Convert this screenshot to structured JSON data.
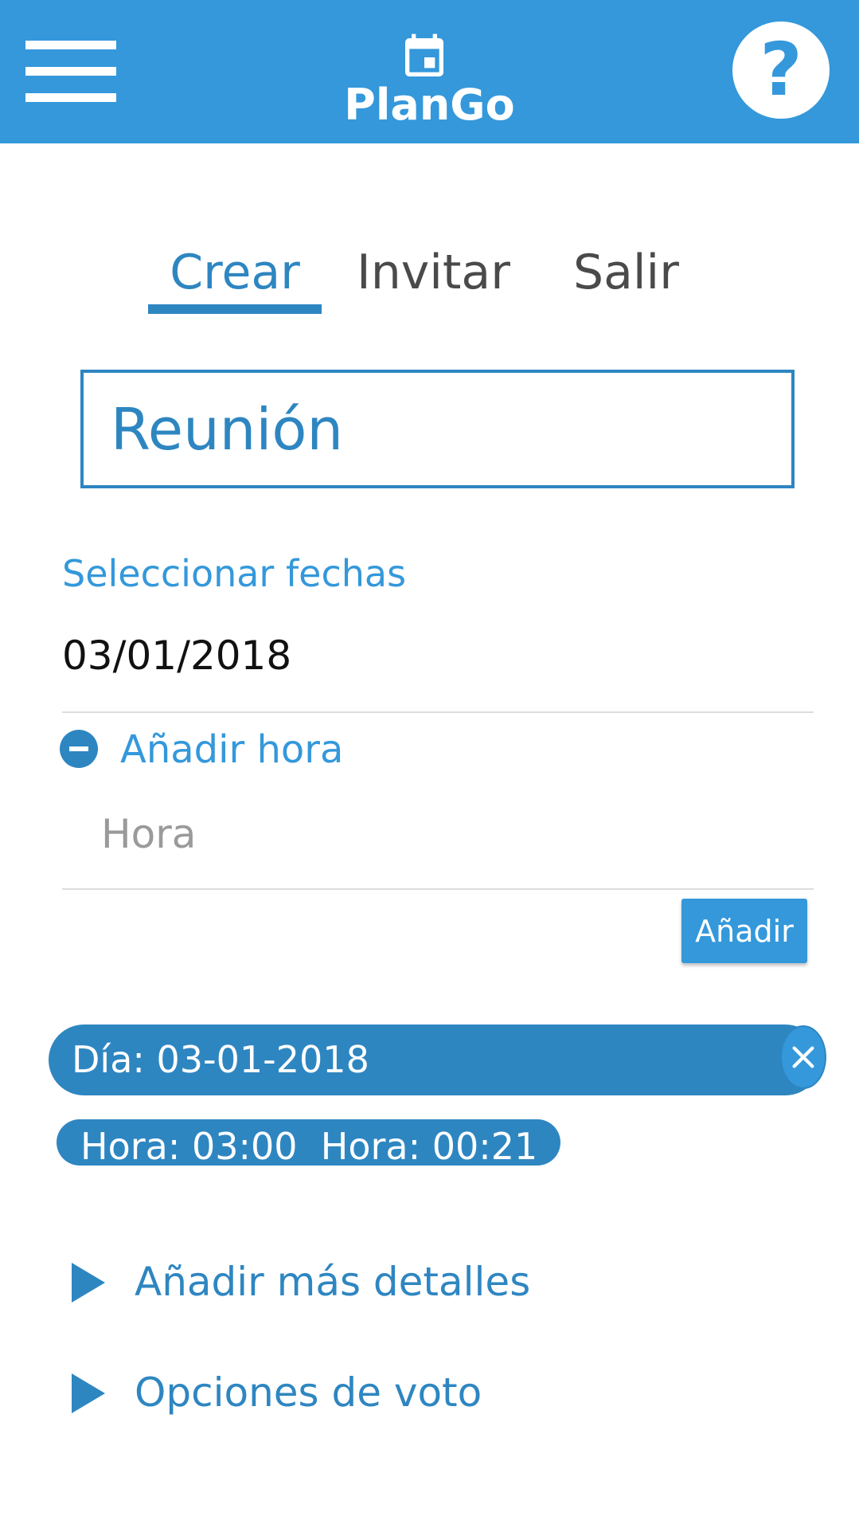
{
  "header": {
    "app_name": "PlanGo",
    "menu_icon": "hamburger-menu-icon",
    "logo_icon": "calendar-icon",
    "help_label": "?",
    "background_color": "#3498db"
  },
  "tabs": [
    {
      "label": "Crear",
      "active": true
    },
    {
      "label": "Invitar",
      "active": false
    },
    {
      "label": "Salir",
      "active": false
    }
  ],
  "form": {
    "title_value": "Reunión",
    "select_dates_label": "Seleccionar fechas",
    "date_value": "03/01/2018",
    "add_hour_label": "Añadir hora",
    "hour_placeholder": "Hora",
    "add_button_label": "Añadir"
  },
  "selected": {
    "day_chip": "Día: 03-01-2018",
    "hours_chip": "Hora: 03:00  Hora: 00:21"
  },
  "expanders": {
    "more_details": "Añadir más detalles",
    "vote_options": "Opciones de voto"
  },
  "colors": {
    "primary": "#3498db",
    "primary_dark": "#2e86c1",
    "text_dark": "#4a4a4a",
    "placeholder": "#9a9a9a"
  }
}
